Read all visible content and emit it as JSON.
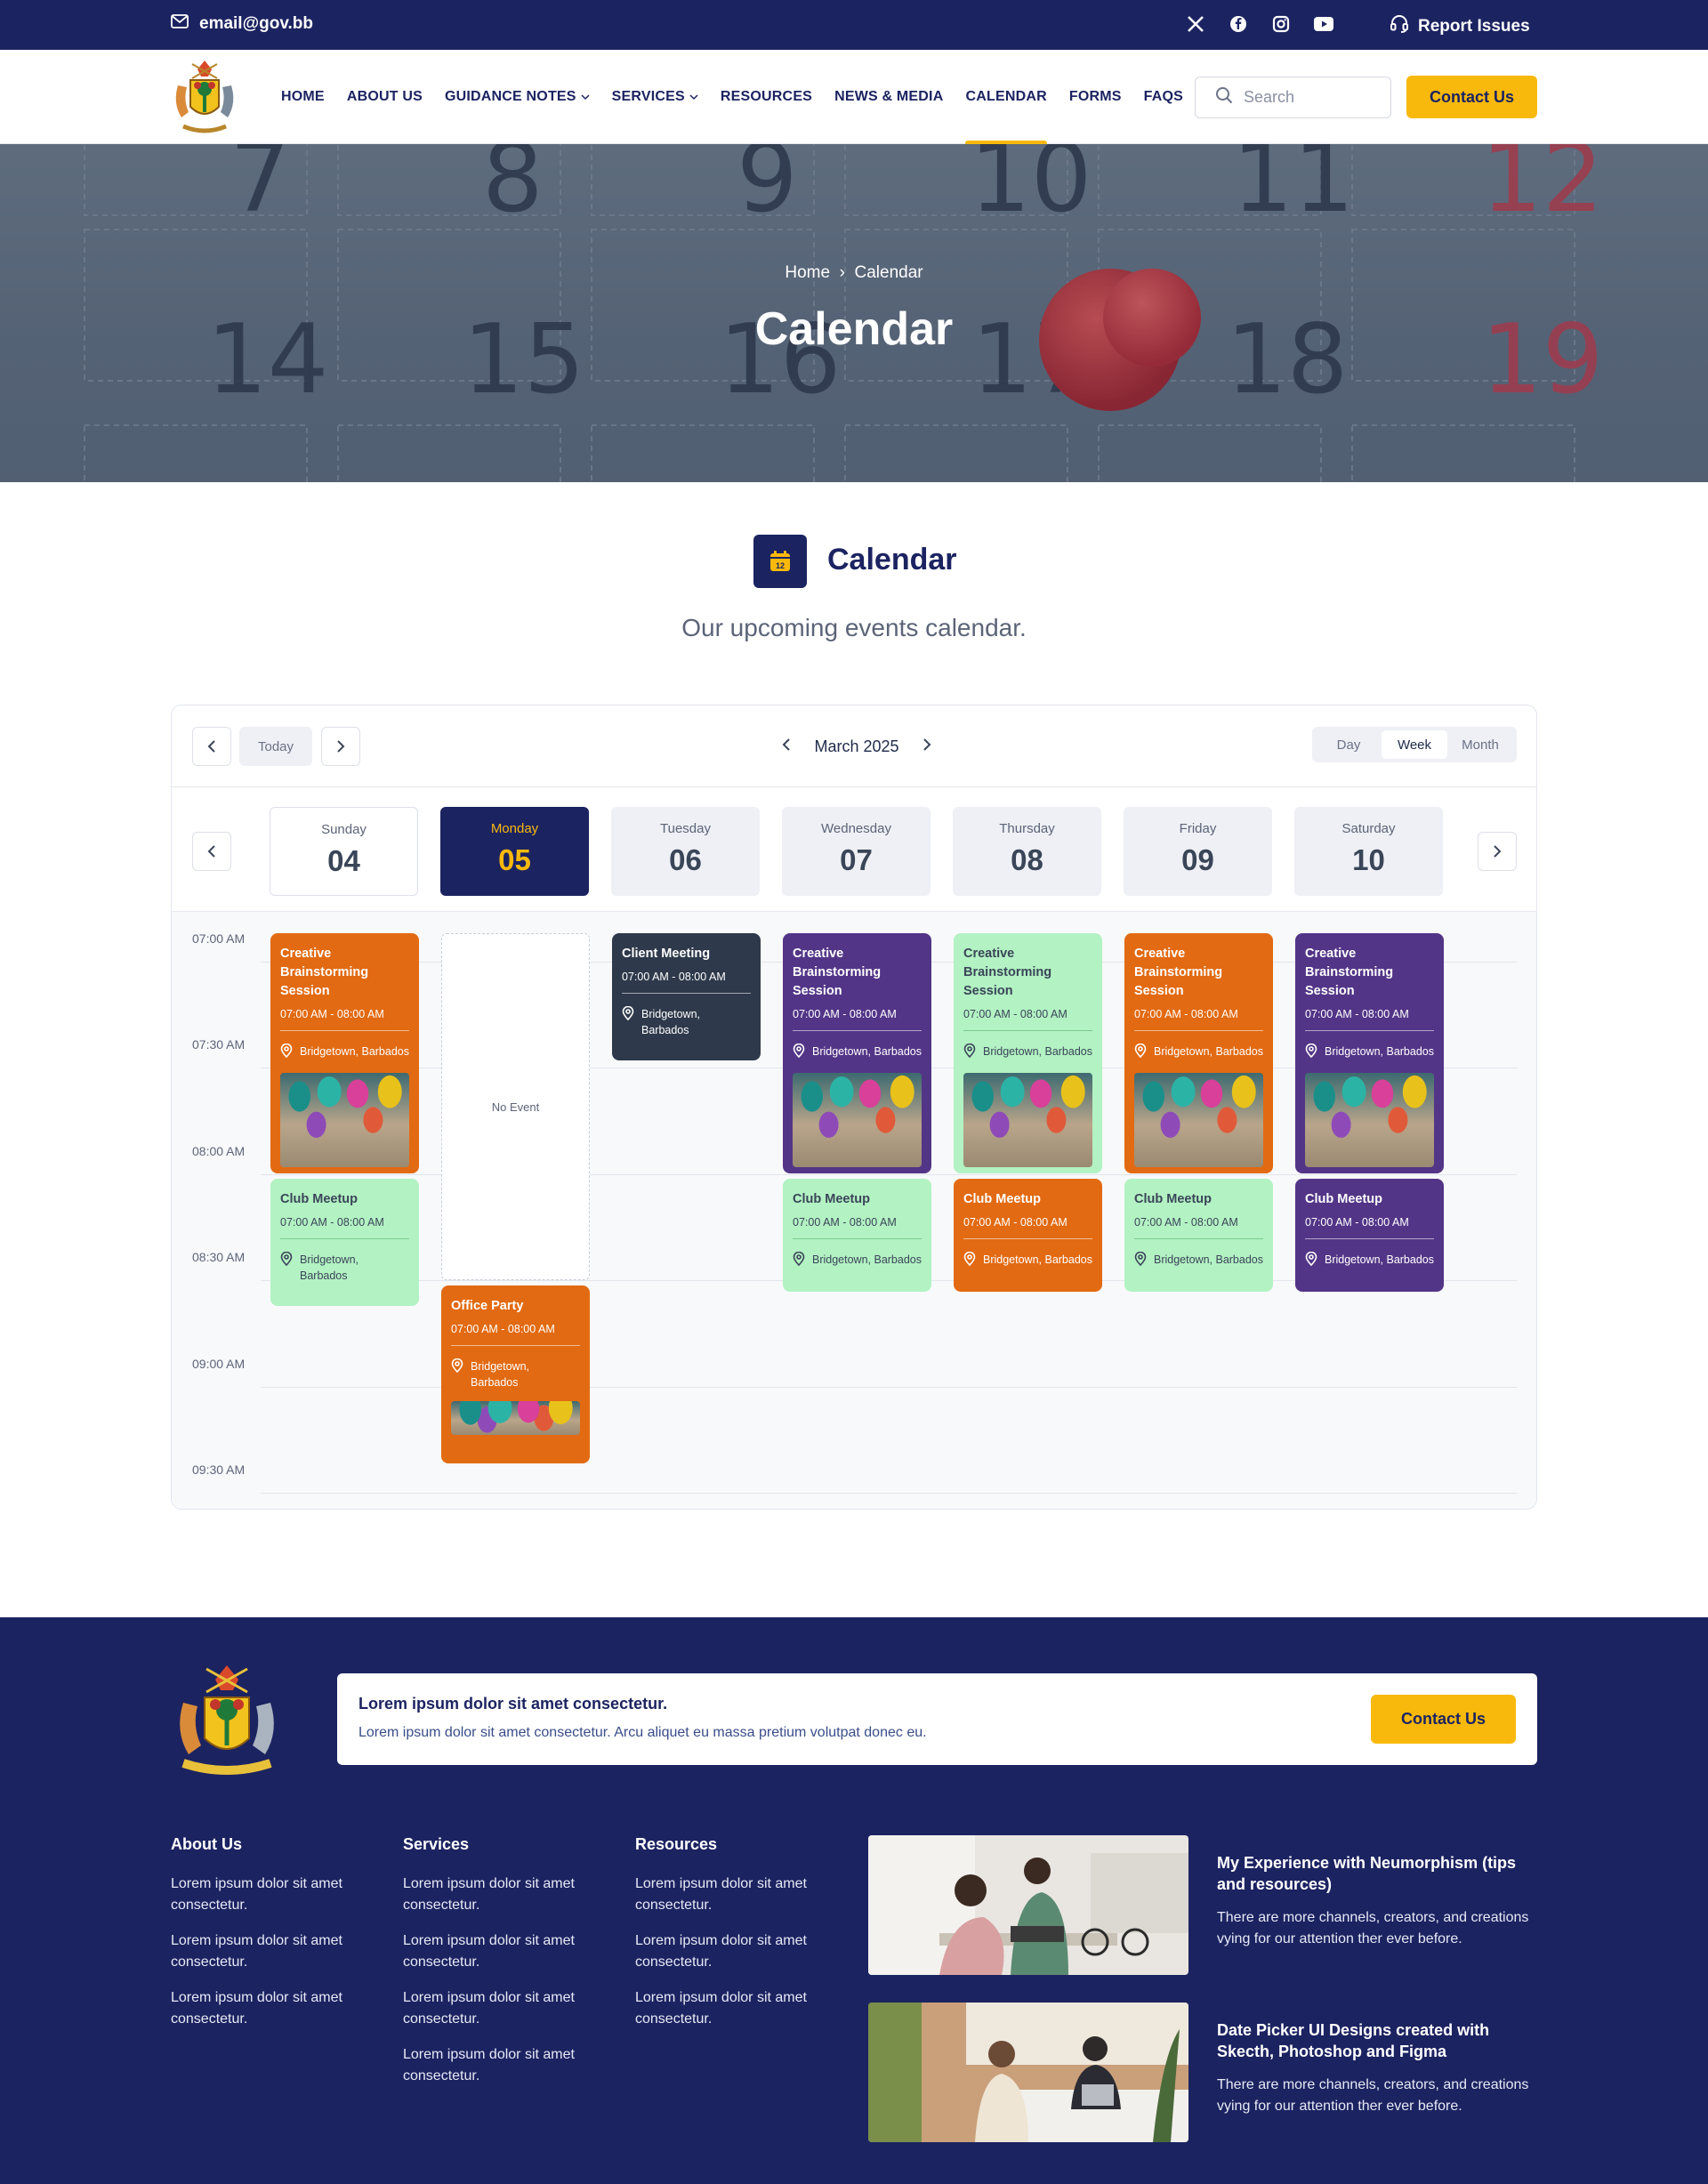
{
  "topbar": {
    "email": "email@gov.bb",
    "report": "Report Issues"
  },
  "nav": {
    "items": [
      {
        "label": "HOME"
      },
      {
        "label": "ABOUT US"
      },
      {
        "label": "GUIDANCE NOTES",
        "dropdown": true
      },
      {
        "label": "SERVICES",
        "dropdown": true
      },
      {
        "label": "RESOURCES"
      },
      {
        "label": "NEWS & MEDIA"
      },
      {
        "label": "CALENDAR",
        "active": true
      },
      {
        "label": "FORMS"
      },
      {
        "label": "FAQS"
      }
    ],
    "search_placeholder": "Search",
    "contact": "Contact Us"
  },
  "hero": {
    "breadcrumb": [
      "Home",
      "Calendar"
    ],
    "separator": "›",
    "title": "Calendar",
    "bg_numbers": [
      "7",
      "8",
      "9",
      "10",
      "11",
      "12",
      "14",
      "15",
      "16",
      "17",
      "18",
      "19"
    ]
  },
  "section": {
    "icon_day": "12",
    "title": "Calendar",
    "subtitle": "Our upcoming events calendar."
  },
  "calendar": {
    "today": "Today",
    "month": "March 2025",
    "views": [
      "Day",
      "Week",
      "Month"
    ],
    "active_view": "Week",
    "days": [
      {
        "name": "Sunday",
        "date": "04",
        "style": "white"
      },
      {
        "name": "Monday",
        "date": "05",
        "style": "selected"
      },
      {
        "name": "Tuesday",
        "date": "06",
        "style": "grey"
      },
      {
        "name": "Wednesday",
        "date": "07",
        "style": "grey"
      },
      {
        "name": "Thursday",
        "date": "08",
        "style": "grey"
      },
      {
        "name": "Friday",
        "date": "09",
        "style": "grey"
      },
      {
        "name": "Saturday",
        "date": "10",
        "style": "grey"
      }
    ],
    "times": [
      "07:00 AM",
      "07:30 AM",
      "08:00 AM",
      "08:30 AM",
      "09:00 AM",
      "09:30 AM"
    ],
    "no_event": "No Event",
    "events": [
      {
        "day": 0,
        "slot": "a",
        "title": "Creative Brainstorming Session",
        "time": "07:00 AM - 08:00 AM",
        "location": "Bridgetown, Barbados",
        "color": "orange",
        "image": true
      },
      {
        "day": 0,
        "slot": "b",
        "title": "Club Meetup",
        "time": "07:00 AM - 08:00 AM",
        "location": "Bridgetown, Barbados",
        "color": "green",
        "wrap": true
      },
      {
        "day": 1,
        "slot": "c",
        "title": "Office Party",
        "time": "07:00 AM - 08:00 AM",
        "location": "Bridgetown, Barbados",
        "color": "orange",
        "image": true,
        "wrap": true
      },
      {
        "day": 2,
        "slot": "d",
        "title": "Client Meeting",
        "time": "07:00 AM - 08:00 AM",
        "location": "Bridgetown, Barbados",
        "color": "dark",
        "wrap": true
      },
      {
        "day": 3,
        "slot": "a",
        "title": "Creative Brainstorming Session",
        "time": "07:00 AM - 08:00 AM",
        "location": "Bridgetown, Barbados",
        "color": "purple",
        "image": true
      },
      {
        "day": 3,
        "slot": "b",
        "title": "Club Meetup",
        "time": "07:00 AM - 08:00 AM",
        "location": "Bridgetown, Barbados",
        "color": "green"
      },
      {
        "day": 4,
        "slot": "a",
        "title": "Creative Brainstorming Session",
        "time": "07:00 AM - 08:00 AM",
        "location": "Bridgetown, Barbados",
        "color": "green",
        "image": true
      },
      {
        "day": 4,
        "slot": "b",
        "title": "Club Meetup",
        "time": "07:00 AM - 08:00 AM",
        "location": "Bridgetown, Barbados",
        "color": "orange"
      },
      {
        "day": 5,
        "slot": "a",
        "title": "Creative Brainstorming Session",
        "time": "07:00 AM - 08:00 AM",
        "location": "Bridgetown, Barbados",
        "color": "orange",
        "image": true
      },
      {
        "day": 5,
        "slot": "b",
        "title": "Club Meetup",
        "time": "07:00 AM - 08:00 AM",
        "location": "Bridgetown, Barbados",
        "color": "green"
      },
      {
        "day": 6,
        "slot": "a",
        "title": "Creative Brainstorming Session",
        "time": "07:00 AM - 08:00 AM",
        "location": "Bridgetown, Barbados",
        "color": "purple",
        "image": true
      },
      {
        "day": 6,
        "slot": "b",
        "title": "Club Meetup",
        "time": "07:00 AM - 08:00 AM",
        "location": "Bridgetown, Barbados",
        "color": "purple"
      }
    ]
  },
  "footer": {
    "banner_title": "Lorem ipsum dolor sit amet consectetur.",
    "banner_text": "Lorem ipsum dolor sit amet consectetur. Arcu aliquet eu massa pretium volutpat donec eu.",
    "contact": "Contact Us",
    "columns": [
      {
        "title": "About Us",
        "links": [
          "Lorem ipsum dolor sit amet consectetur.",
          "Lorem ipsum dolor sit amet consectetur.",
          "Lorem ipsum dolor sit amet consectetur."
        ]
      },
      {
        "title": "Services",
        "links": [
          "Lorem ipsum dolor sit amet consectetur.",
          "Lorem ipsum dolor sit amet consectetur.",
          "Lorem ipsum dolor sit amet consectetur.",
          "Lorem ipsum dolor sit amet consectetur."
        ]
      },
      {
        "title": "Resources",
        "links": [
          "Lorem ipsum dolor sit amet consectetur.",
          "Lorem ipsum dolor sit amet consectetur.",
          "Lorem ipsum dolor sit amet consectetur."
        ]
      }
    ],
    "posts": [
      {
        "title": "My Experience with Neumorphism (tips and resources)",
        "text": "There are more channels, creators, and creations vying for our attention ther ever before."
      },
      {
        "title": "Date Picker UI Designs created with Skecth, Photoshop and Figma",
        "text": "There are more channels, creators, and creations vying for our attention ther ever before."
      }
    ]
  },
  "colors": {
    "navy": "#1c2361",
    "yellow": "#f8b90c",
    "orange": "#e26a12",
    "purple": "#533587",
    "green": "#b3f2c3",
    "dark": "#2e3a4b"
  }
}
